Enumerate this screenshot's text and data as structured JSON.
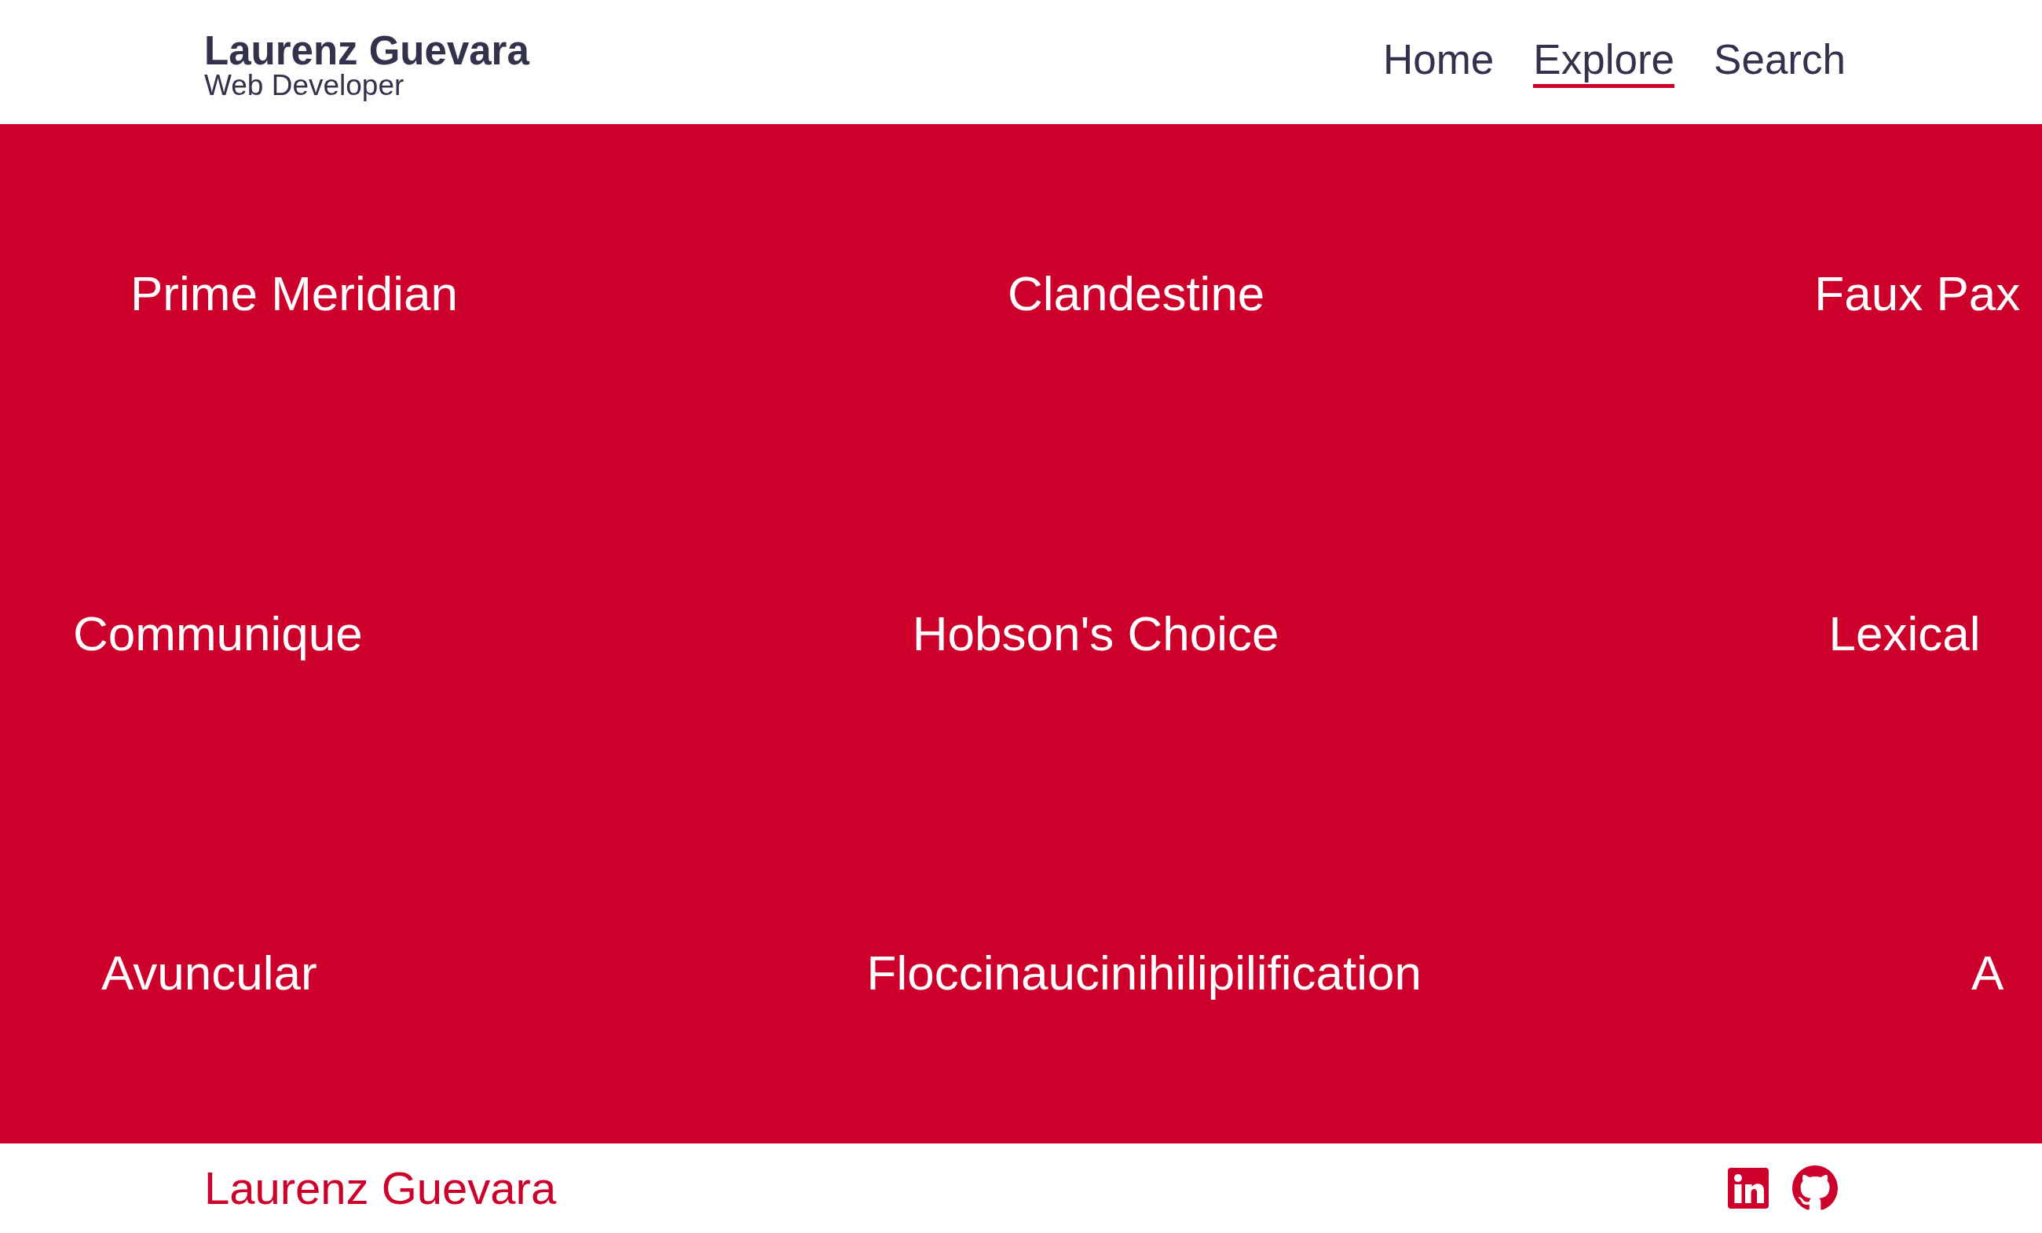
{
  "header": {
    "name": "Laurenz Guevara",
    "tagline": "Web Developer",
    "nav": [
      {
        "label": "Home",
        "selected": false
      },
      {
        "label": "Explore",
        "selected": true
      },
      {
        "label": "Search",
        "selected": false
      }
    ]
  },
  "grid": {
    "rows": [
      [
        "Prime Meridian",
        "Clandestine",
        "Faux Pax"
      ],
      [
        "Communique",
        "Hobson's Choice",
        "Lexical"
      ],
      [
        "Avuncular",
        "Floccinaucinihilipilification",
        "A"
      ]
    ]
  },
  "footer": {
    "name": "Laurenz Guevara",
    "links": [
      {
        "kind": "linkedin"
      },
      {
        "kind": "github"
      }
    ]
  }
}
